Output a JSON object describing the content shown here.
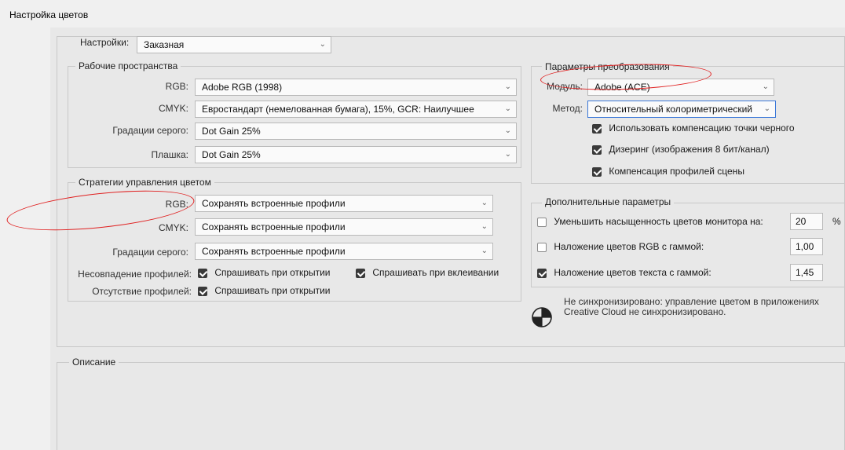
{
  "window": {
    "title": "Настройка цветов"
  },
  "settings": {
    "label": "Настройки:",
    "value": "Заказная"
  },
  "working_spaces": {
    "title": "Рабочие пространства",
    "rows": [
      {
        "label": "RGB:",
        "value": "Adobe RGB (1998)"
      },
      {
        "label": "CMYK:",
        "value": "Евростандарт (немелованная бумага), 15%, GCR: Наилучшее"
      },
      {
        "label": "Градации серого:",
        "value": "Dot Gain 25%"
      },
      {
        "label": "Плашка:",
        "value": "Dot Gain 25%"
      }
    ]
  },
  "policies": {
    "title": "Стратегии управления цветом",
    "rows": [
      {
        "label": "RGB:",
        "value": "Сохранять встроенные профили"
      },
      {
        "label": "CMYK:",
        "value": "Сохранять встроенные профили"
      },
      {
        "label": "Градации серого:",
        "value": "Сохранять встроенные профили"
      }
    ],
    "mismatch": {
      "label": "Несовпадение профилей:",
      "ask_open": "Спрашивать при открытии",
      "ask_open_checked": true,
      "ask_paste": "Спрашивать при вклеивании",
      "ask_paste_checked": true
    },
    "missing": {
      "label": "Отсутствие профилей:",
      "ask_open": "Спрашивать при открытии",
      "ask_open_checked": true
    }
  },
  "conversion": {
    "title": "Параметры преобразования",
    "engine_label": "Модуль:",
    "engine_value": "Adobe (ACE)",
    "intent_label": "Метод:",
    "intent_value": "Относительный колориметрический",
    "options": [
      {
        "label": "Использовать компенсацию точки черного",
        "checked": true
      },
      {
        "label": "Дизеринг (изображения 8 бит/канал)",
        "checked": true
      },
      {
        "label": "Компенсация профилей сцены",
        "checked": true
      }
    ]
  },
  "advanced": {
    "title": "Дополнительные параметры",
    "rows": [
      {
        "label": "Уменьшить насыщенность цветов монитора на:",
        "checked": false,
        "value": "20",
        "unit": "%"
      },
      {
        "label": "Наложение цветов RGB с гаммой:",
        "checked": false,
        "value": "1,00"
      },
      {
        "label": "Наложение цветов текста с гаммой:",
        "checked": true,
        "value": "1,45"
      }
    ]
  },
  "sync": {
    "message": "Не синхронизировано: управление цветом в приложениях Creative Cloud не синхронизировано.",
    "icon": "sync-status-icon"
  },
  "description": {
    "title": "Описание"
  },
  "colors": {
    "annotation": "#e02020",
    "focus": "#3b78d8",
    "checkbox": "#3a3a3a"
  }
}
